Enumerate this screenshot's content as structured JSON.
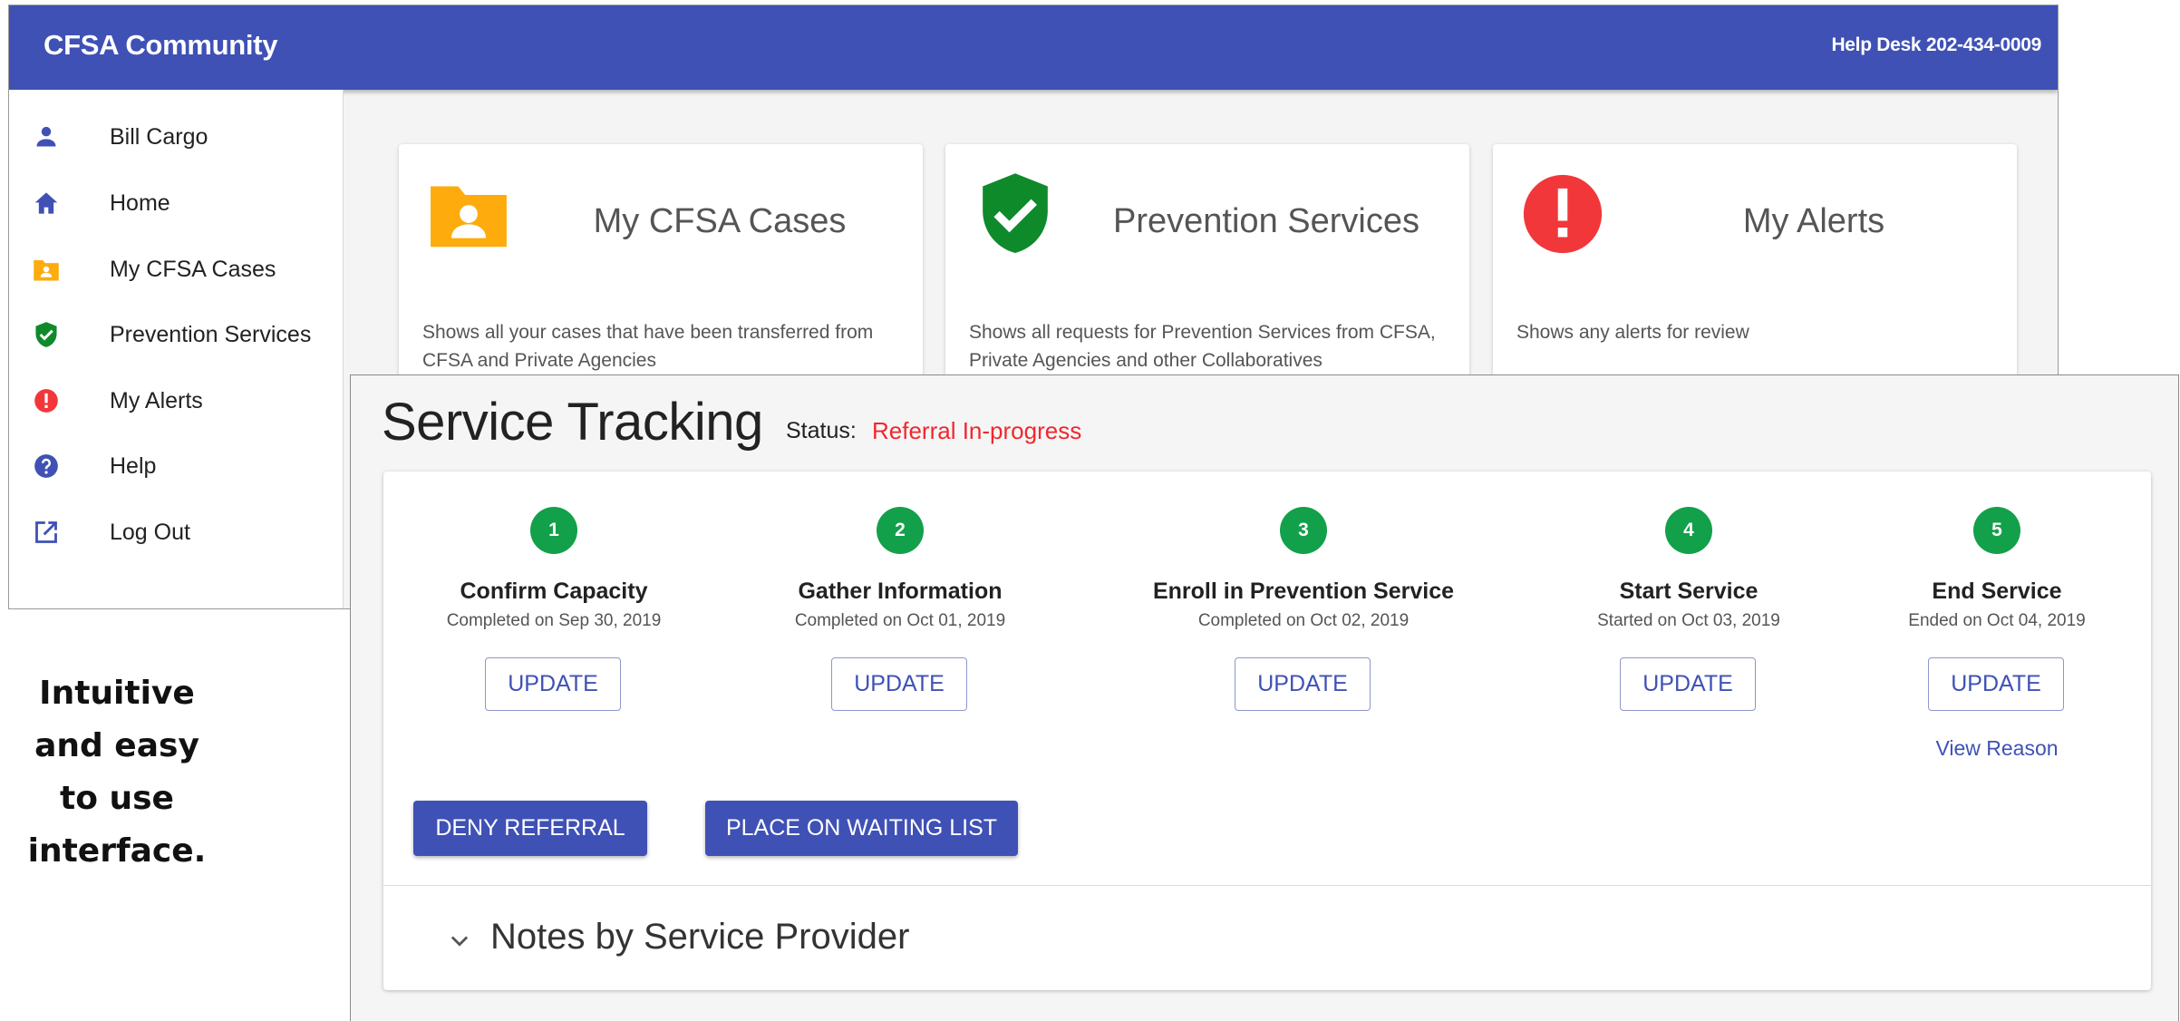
{
  "header": {
    "title": "CFSA Community",
    "help_desk": "Help Desk 202-434-0009",
    "bg_color": "#3f51b5"
  },
  "sidebar": {
    "items": [
      {
        "label": "Bill Cargo",
        "icon": "person-icon"
      },
      {
        "label": "Home",
        "icon": "home-icon"
      },
      {
        "label": "My CFSA Cases",
        "icon": "folder-person-icon"
      },
      {
        "label": "Prevention Services",
        "icon": "shield-check-icon"
      },
      {
        "label": "My Alerts",
        "icon": "alert-icon"
      },
      {
        "label": "Help",
        "icon": "help-icon"
      },
      {
        "label": "Log Out",
        "icon": "open-external-icon"
      }
    ]
  },
  "cards": [
    {
      "title": "My CFSA Cases",
      "description": "Shows all your cases that have been transferred from CFSA and Private Agencies",
      "icon": "folder-person-icon",
      "color": "#fdab0d"
    },
    {
      "title": "Prevention Services",
      "description": "Shows all requests for Prevention Services from CFSA, Private Agencies and other Collaboratives",
      "icon": "shield-check-icon",
      "color": "#0e8a2b"
    },
    {
      "title": "My Alerts",
      "description": "Shows any alerts for review",
      "icon": "alert-icon",
      "color": "#f2373a"
    }
  ],
  "tracking": {
    "title": "Service Tracking",
    "status_label": "Status:",
    "status_value": "Referral In-progress",
    "steps": [
      {
        "number": "1",
        "name": "Confirm Capacity",
        "date": "Completed on Sep 30, 2019",
        "button": "UPDATE"
      },
      {
        "number": "2",
        "name": "Gather Information",
        "date": "Completed on Oct 01, 2019",
        "button": "UPDATE"
      },
      {
        "number": "3",
        "name": "Enroll in Prevention Service",
        "date": "Completed on Oct 02, 2019",
        "button": "UPDATE"
      },
      {
        "number": "4",
        "name": "Start Service",
        "date": "Started on Oct 03, 2019",
        "button": "UPDATE"
      },
      {
        "number": "5",
        "name": "End Service",
        "date": "Ended on Oct 04, 2019",
        "button": "UPDATE",
        "link": "View Reason"
      }
    ],
    "deny_label": "DENY REFERRAL",
    "waitlist_label": "PLACE ON WAITING LIST",
    "notes_title": "Notes by Service Provider"
  },
  "caption": {
    "lines": [
      "Intuitive",
      "and easy",
      "to use",
      "interface."
    ]
  }
}
